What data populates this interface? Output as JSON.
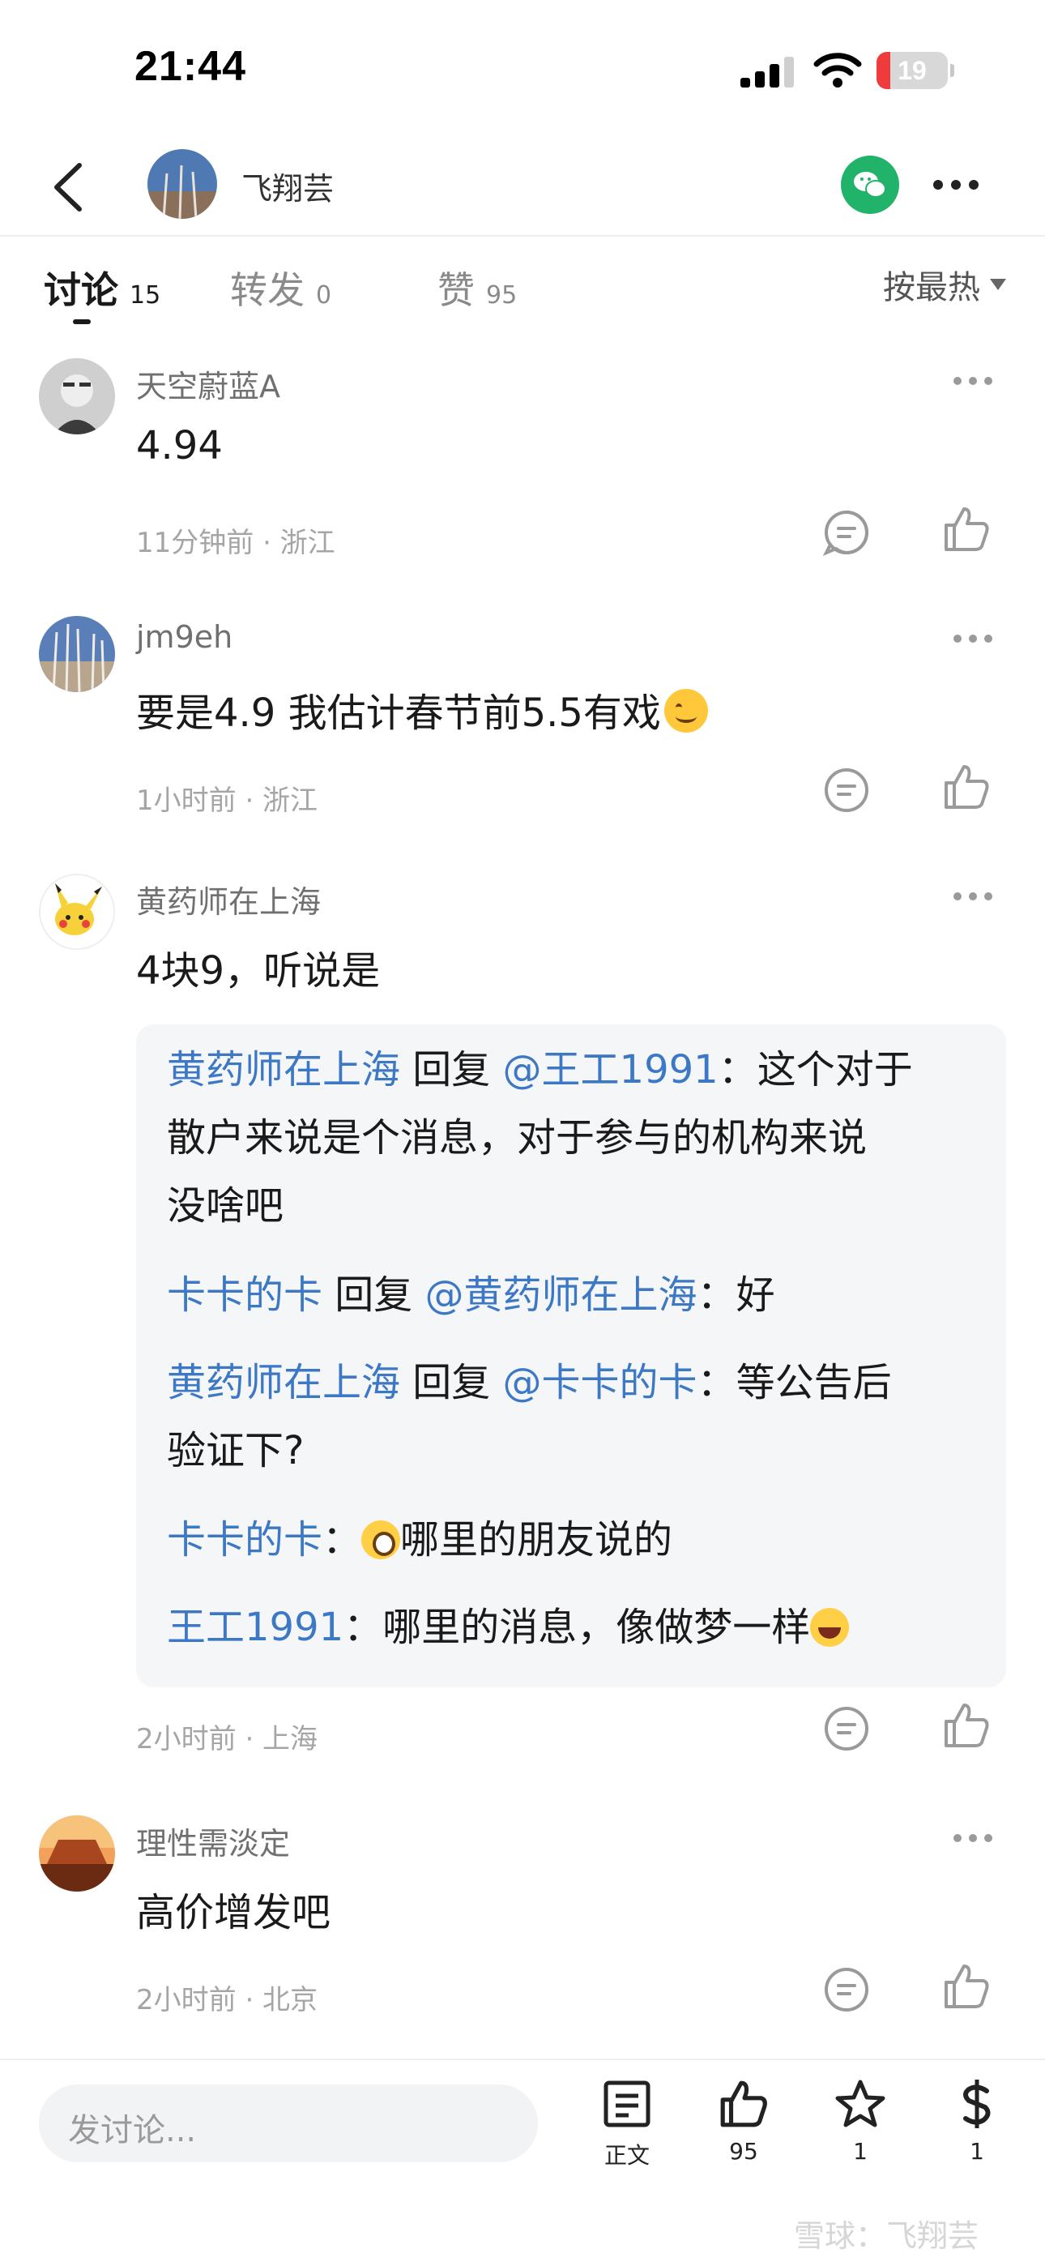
{
  "status_bar": {
    "time": "21:44",
    "battery_level": "19",
    "battery_fraction": 0.19
  },
  "nav": {
    "title": "飞翔芸"
  },
  "tabs": [
    {
      "label": "讨论",
      "count": "15"
    },
    {
      "label": "转发",
      "count": "0"
    },
    {
      "label": "赞",
      "count": "95"
    }
  ],
  "sort": {
    "label": "按最热"
  },
  "comments": [
    {
      "user": "天空蔚蓝A",
      "text": "4.94",
      "meta": "11分钟前 · 浙江"
    },
    {
      "user": "jm9eh",
      "text": "要是4.9 我估计春节前5.5有戏",
      "meta": "1小时前 · 浙江"
    },
    {
      "user": "黄药师在上海",
      "text": "4块9，听说是",
      "meta": "2小时前 · 上海"
    },
    {
      "user": "理性需淡定",
      "text": "高价增发吧",
      "meta": "2小时前 · 北京"
    }
  ],
  "replies": [
    {
      "user": "黄药师在上海",
      "verb": " 回复 ",
      "target": "@王工1991",
      "sep": "：",
      "line1": "这个对于",
      "line2": "散户来说是个消息，对于参与的机构来说",
      "line3": "没啥吧"
    },
    {
      "user": "卡卡的卡",
      "verb": " 回复 ",
      "target": "@黄药师在上海",
      "sep": "：",
      "line1": "好"
    },
    {
      "user": "黄药师在上海",
      "verb": " 回复 ",
      "target": "@卡卡的卡",
      "sep": "：",
      "line1": "等公告后",
      "line2": "验证下?"
    },
    {
      "user": "卡卡的卡",
      "sep": "：",
      "line1": "哪里的朋友说的"
    },
    {
      "user": "王工1991",
      "sep": "：",
      "line1": "哪里的消息，像做梦一样"
    }
  ],
  "bottom_bar": {
    "placeholder": "发讨论...",
    "article_label": "正文",
    "like_count": "95",
    "favorite_count": "1",
    "reward_count": "1"
  },
  "watermark": "雪球：飞翔芸"
}
